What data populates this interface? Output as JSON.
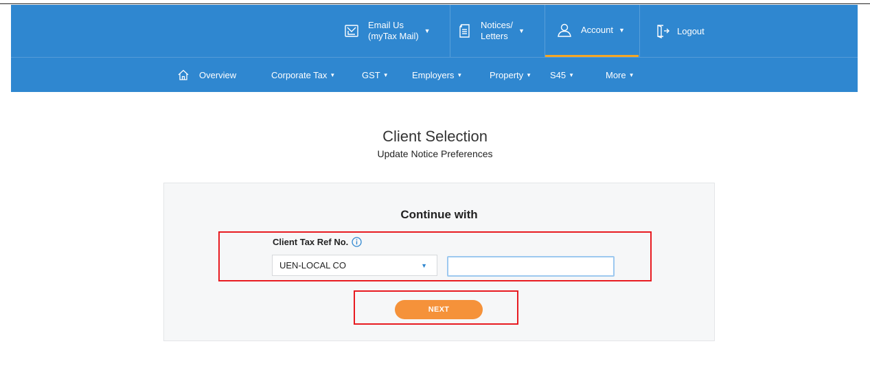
{
  "header": {
    "email": {
      "line1": "Email Us",
      "line2": "(myTax Mail)",
      "icon": "mail-icon"
    },
    "notices": {
      "line1": "Notices/",
      "line2": "Letters",
      "icon": "document-icon"
    },
    "account": {
      "label": "Account",
      "icon": "user-icon"
    },
    "logout": {
      "label": "Logout",
      "icon": "logout-icon"
    },
    "caret": "▼"
  },
  "nav": {
    "items": [
      {
        "label": "Overview",
        "icon": "home-icon"
      },
      {
        "label": "Corporate Tax",
        "caret": "▼"
      },
      {
        "label": "GST",
        "caret": "▼"
      },
      {
        "label": "Employers",
        "caret": "▼"
      },
      {
        "label": "Property",
        "caret": "▼"
      },
      {
        "label": "S45",
        "caret": "▼"
      },
      {
        "label": "More",
        "caret": "▼"
      }
    ]
  },
  "page": {
    "title": "Client Selection",
    "subtitle": "Update Notice Preferences"
  },
  "form": {
    "heading": "Continue with",
    "field_label": "Client Tax Ref No.",
    "select_value": "UEN-LOCAL CO",
    "select_caret": "▼",
    "input_value": "",
    "next_label": "NEXT"
  },
  "colors": {
    "header_bg": "#2f87d0",
    "accent": "#f5923a",
    "highlight": "#e8191f"
  }
}
